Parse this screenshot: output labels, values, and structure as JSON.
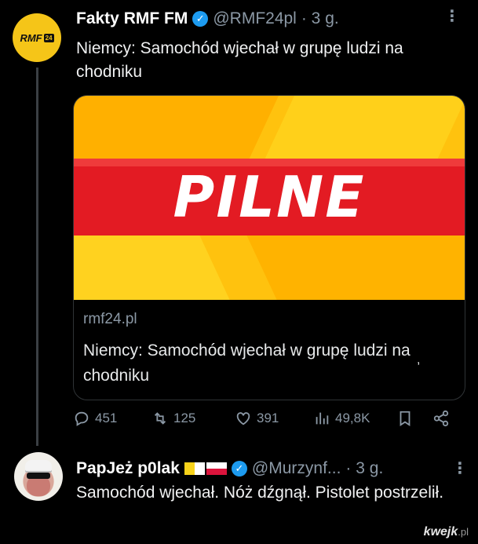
{
  "tweet1": {
    "author_name": "Fakty RMF FM",
    "handle": "@RMF24pl",
    "time": "· 3 g.",
    "text": "Niemcy: Samochód wjechał w grupę ludzi na chodniku",
    "avatar_logo": "RMF",
    "avatar_badge": "24",
    "card": {
      "image_text": "PILNE",
      "domain": "rmf24.pl",
      "title": "Niemcy: Samochód wjechał w grupę ludzi na chodniku"
    },
    "actions": {
      "replies": "451",
      "reposts": "125",
      "likes": "391",
      "views": "49,8K"
    }
  },
  "tweet2": {
    "author_name": "PapJeż p0lak",
    "handle": "@Murzynf...",
    "time": "· 3 g.",
    "text": "Samochód wjechał. Nóż dźgnął. Pistolet postrzelił."
  },
  "watermark": {
    "brand": "kwejk",
    "suffix": ".pl"
  },
  "icons": [
    "more-icon",
    "verified-icon",
    "reply-icon",
    "repost-icon",
    "like-icon",
    "views-icon",
    "bookmark-icon",
    "share-icon"
  ],
  "colors": {
    "background": "#000000",
    "verified": "#1d9bf0",
    "muted": "#8b98a5",
    "pilne_red": "#e31b23",
    "pilne_yellow": "#ffc20e"
  }
}
